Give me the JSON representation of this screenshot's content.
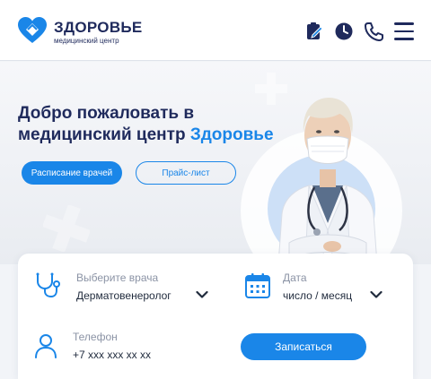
{
  "brand": {
    "name": "ЗДОРОВЬЕ",
    "subtitle": "медицинский центр"
  },
  "hero": {
    "title_prefix": "Добро пожаловать в медицинский центр ",
    "title_accent": "Здоровье",
    "schedule_button": "Расписание врачей",
    "price_button": "Прайс-лист"
  },
  "form": {
    "doctor_label": "Выберите врача",
    "doctor_value": "Дерматовенеролог",
    "date_label": "Дата",
    "date_value": "число / месяц",
    "phone_label": "Телефон",
    "phone_value": "+7 xxx xxx xx xx",
    "submit_button": "Записаться"
  },
  "colors": {
    "primary": "#1a86e8",
    "dark": "#1f2a5c"
  }
}
